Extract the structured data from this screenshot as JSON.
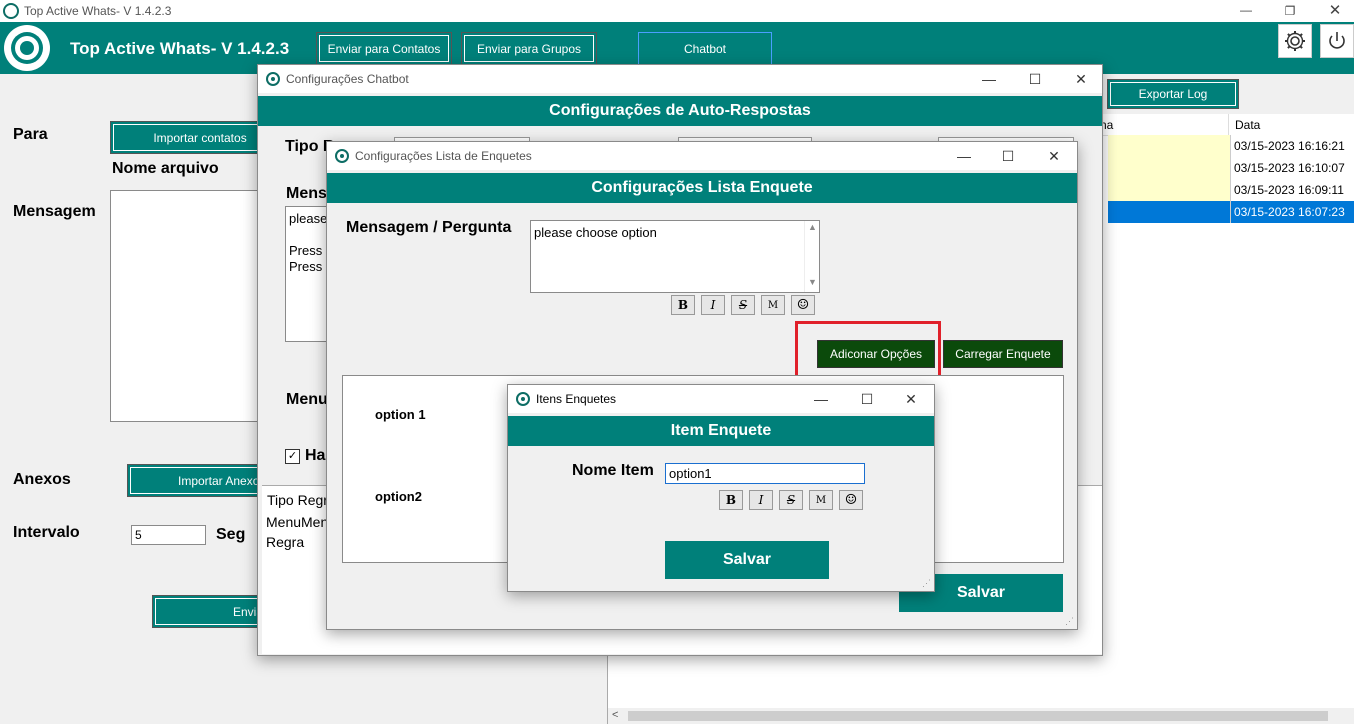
{
  "app": {
    "window_title": "Top Active Whats- V 1.4.2.3",
    "header_title": "Top Active Whats- V 1.4.2.3",
    "nav": {
      "enviar_contatos": "Enviar para Contatos",
      "enviar_grupos": "Enviar para Grupos",
      "chatbot": "Chatbot"
    }
  },
  "main": {
    "para_label": "Para",
    "importar_contatos": "Importar contatos",
    "nome_arquivo": "Nome arquivo",
    "mensagem_label": "Mensagem",
    "anexos_label": "Anexos",
    "importar_anexos": "Importar Anexos",
    "intervalo_label": "Intervalo",
    "intervalo_value": "5",
    "seg_label": "Seg",
    "enviar_partial": "Envia"
  },
  "log": {
    "exportar": "Exportar Log",
    "col1_partial": "na",
    "col2": "Data",
    "rows": [
      {
        "data": "03/15-2023 16:16:21"
      },
      {
        "data": "03/15-2023 16:10:07"
      },
      {
        "data": "03/15-2023 16:09:11"
      },
      {
        "data": "03/15-2023 16:07:23"
      }
    ]
  },
  "chatbot_win": {
    "title": "Configurações Chatbot",
    "band": "Configurações de Auto-Respostas",
    "tipo_partial": "Tipo R",
    "mens_partial": "Mens",
    "msg_lines": [
      "please",
      "",
      "Press",
      "Press"
    ],
    "menu_partial": "Menu",
    "ha_partial": "Ha",
    "list_items": [
      "Tipo Regr",
      "MenuMens",
      "Regra"
    ]
  },
  "enquete_win": {
    "title": "Configurações Lista de Enquetes",
    "band": "Configurações Lista Enquete",
    "mensagem_label": "Mensagem / Pergunta",
    "mensagem_value": "please choose option",
    "adicionar": "Adiconar Opções",
    "carregar": "Carregar Enquete",
    "options": [
      "option 1",
      "option2"
    ],
    "salvar": "Salvar"
  },
  "item_win": {
    "title": "Itens Enquetes",
    "band": "Item Enquete",
    "nome_label": "Nome Item",
    "nome_value": "option1",
    "salvar": "Salvar"
  },
  "format_buttons": [
    "B",
    "I",
    "S",
    "M",
    "☺"
  ],
  "colors": {
    "teal": "#00807a",
    "dark_green": "#0b4a0b",
    "highlight_red": "#e0202a",
    "selected_blue": "#0078d7",
    "row_yellow": "#ffffcc"
  }
}
